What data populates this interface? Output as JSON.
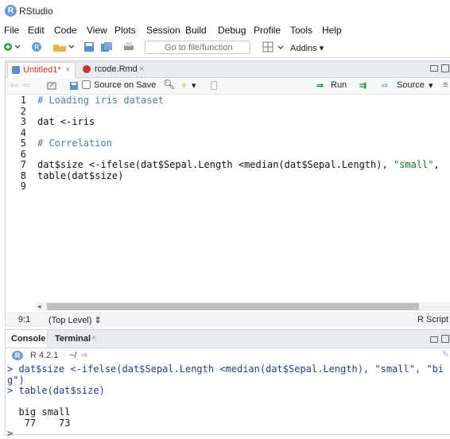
{
  "window": {
    "title": "RStudio",
    "logo_letter": "R"
  },
  "menu": [
    "File",
    "Edit",
    "Code",
    "View",
    "Plots",
    "Session",
    "Build",
    "Debug",
    "Profile",
    "Tools",
    "Help"
  ],
  "toolbar": {
    "goto_placeholder": "Go to file/function",
    "addins_label": "Addins"
  },
  "editor": {
    "tabs": [
      {
        "label": "Untitled1*",
        "active": true
      },
      {
        "label": "rcode.Rmd",
        "active": false
      }
    ],
    "toolbar": {
      "source_on_save_label": "Source on Save",
      "run_label": "Run",
      "source_label": "Source"
    },
    "lines": [
      "# Loading iris dataset",
      "",
      "dat <-iris",
      "",
      "# Correlation",
      "",
      "dat$size <-ifelse(dat$Sepal.Length <median(dat$Sepal.Length), \"small\",",
      "table(dat$size)",
      ""
    ],
    "line_numbers": [
      "1",
      "2",
      "3",
      "4",
      "5",
      "6",
      "7",
      "8",
      "9"
    ],
    "status": {
      "position": "9:1",
      "scope": "(Top Level)",
      "language": "R Script"
    }
  },
  "console": {
    "tabs": [
      {
        "label": "Console",
        "active": true
      },
      {
        "label": "Terminal",
        "active": false
      }
    ],
    "r_version": "R 4.2.1",
    "cwd": "~/",
    "lines": [
      "> dat$size <-ifelse(dat$Sepal.Length <median(dat$Sepal.Length), \"small\", \"bi",
      "g\")",
      "> table(dat$size)",
      "",
      "  big small",
      "   77    73",
      ">"
    ]
  },
  "colors": {
    "accent": "#4b7dae",
    "string": "#0a7a33",
    "run_green": "#1a9b3a"
  }
}
